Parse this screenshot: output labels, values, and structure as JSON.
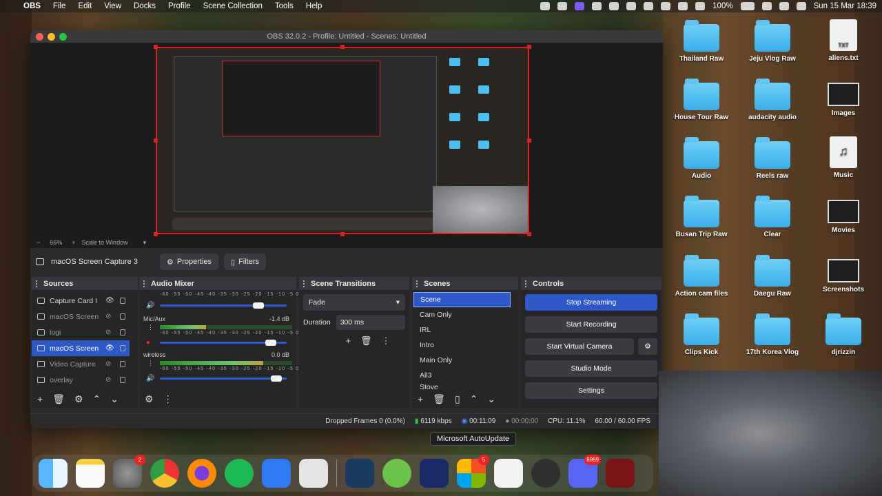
{
  "menubar": {
    "app": "OBS",
    "items": [
      "File",
      "Edit",
      "View",
      "Docks",
      "Profile",
      "Scene Collection",
      "Tools",
      "Help"
    ],
    "battery": "100%",
    "datetime": "Sun 15 Mar  18:39"
  },
  "desktop": [
    {
      "label": "Thailand Raw",
      "type": "folder"
    },
    {
      "label": "Jeju Vlog Raw",
      "type": "folder"
    },
    {
      "label": "aliens.txt",
      "type": "file",
      "tag": "TXT"
    },
    {
      "label": "House Tour Raw",
      "type": "folder"
    },
    {
      "label": "audacity audio",
      "type": "folder"
    },
    {
      "label": "Images",
      "type": "image"
    },
    {
      "label": "Audio",
      "type": "folder"
    },
    {
      "label": "Reels raw",
      "type": "folder"
    },
    {
      "label": "Music",
      "type": "file",
      "tag": "♫"
    },
    {
      "label": "Busan Trip Raw",
      "type": "folder"
    },
    {
      "label": "Clear",
      "type": "folder"
    },
    {
      "label": "Movies",
      "type": "image"
    },
    {
      "label": "Action cam files",
      "type": "folder"
    },
    {
      "label": "Daegu Raw",
      "type": "folder"
    },
    {
      "label": "Screenshots",
      "type": "image"
    },
    {
      "label": "Clips Kick",
      "type": "folder"
    },
    {
      "label": "17th Korea Vlog",
      "type": "folder"
    },
    {
      "label": "djrizzin",
      "type": "folder"
    }
  ],
  "window": {
    "title": "OBS 32.0.2 - Profile: Untitled - Scenes: Untitled"
  },
  "preview": {
    "zoom": "66%",
    "scale_mode": "Scale to Window",
    "minus": "−",
    "plus": "+"
  },
  "source_bar": {
    "selected": "macOS Screen Capture 3",
    "properties": "Properties",
    "filters": "Filters"
  },
  "sources": {
    "title": "Sources",
    "items": [
      {
        "name": "Capture Card I",
        "visible": "👁",
        "hidden": false
      },
      {
        "name": "macOS Screen",
        "visible": "⊘",
        "hidden": true
      },
      {
        "name": "logi",
        "visible": "⊘",
        "hidden": true
      },
      {
        "name": "macOS Screen",
        "visible": "👁",
        "hidden": false,
        "selected": true
      },
      {
        "name": "Video Capture",
        "visible": "⊘",
        "hidden": true
      },
      {
        "name": "overlay",
        "visible": "⊘",
        "hidden": true
      }
    ]
  },
  "mixer": {
    "title": "Audio Mixer",
    "scale": "-60 -55 -50 -45 -40 -35 -30 -25 -20 -15 -10 -5 0",
    "channels": [
      {
        "name": "",
        "db": "",
        "level": 0.0,
        "volume": 0.82
      },
      {
        "name": "Mic/Aux",
        "db": "-1.4 dB",
        "level": 0.35,
        "volume": 0.92
      },
      {
        "name": "wireless",
        "db": "0.0 dB",
        "level": 0.78,
        "volume": 0.96
      }
    ]
  },
  "transitions": {
    "title": "Scene Transitions",
    "selected": "Fade",
    "duration_label": "Duration",
    "duration": "300 ms"
  },
  "scenes": {
    "title": "Scenes",
    "items": [
      "Scene",
      "Cam Only",
      "IRL",
      "Intro",
      "Main Only",
      "All3",
      "Stove"
    ]
  },
  "controls": {
    "title": "Controls",
    "buttons": [
      "Stop Streaming",
      "Start Recording",
      "Start Virtual Camera",
      "Studio Mode",
      "Settings"
    ]
  },
  "status": {
    "dropped": "Dropped Frames 0 (0.0%)",
    "bitrate": "6119 kbps",
    "stream_time": "00:11:09",
    "rec_time": "00:00:00",
    "cpu": "CPU: 11.1%",
    "fps": "60.00 / 60.00 FPS"
  },
  "tooltip": "Microsoft AutoUpdate",
  "dock": {
    "badges": {
      "settings": "2",
      "msupdate": "5",
      "discord": "8989"
    }
  },
  "colors": {
    "accent": "#2e58c8",
    "record_red": "#e02020",
    "folder": "#4cbef0"
  }
}
